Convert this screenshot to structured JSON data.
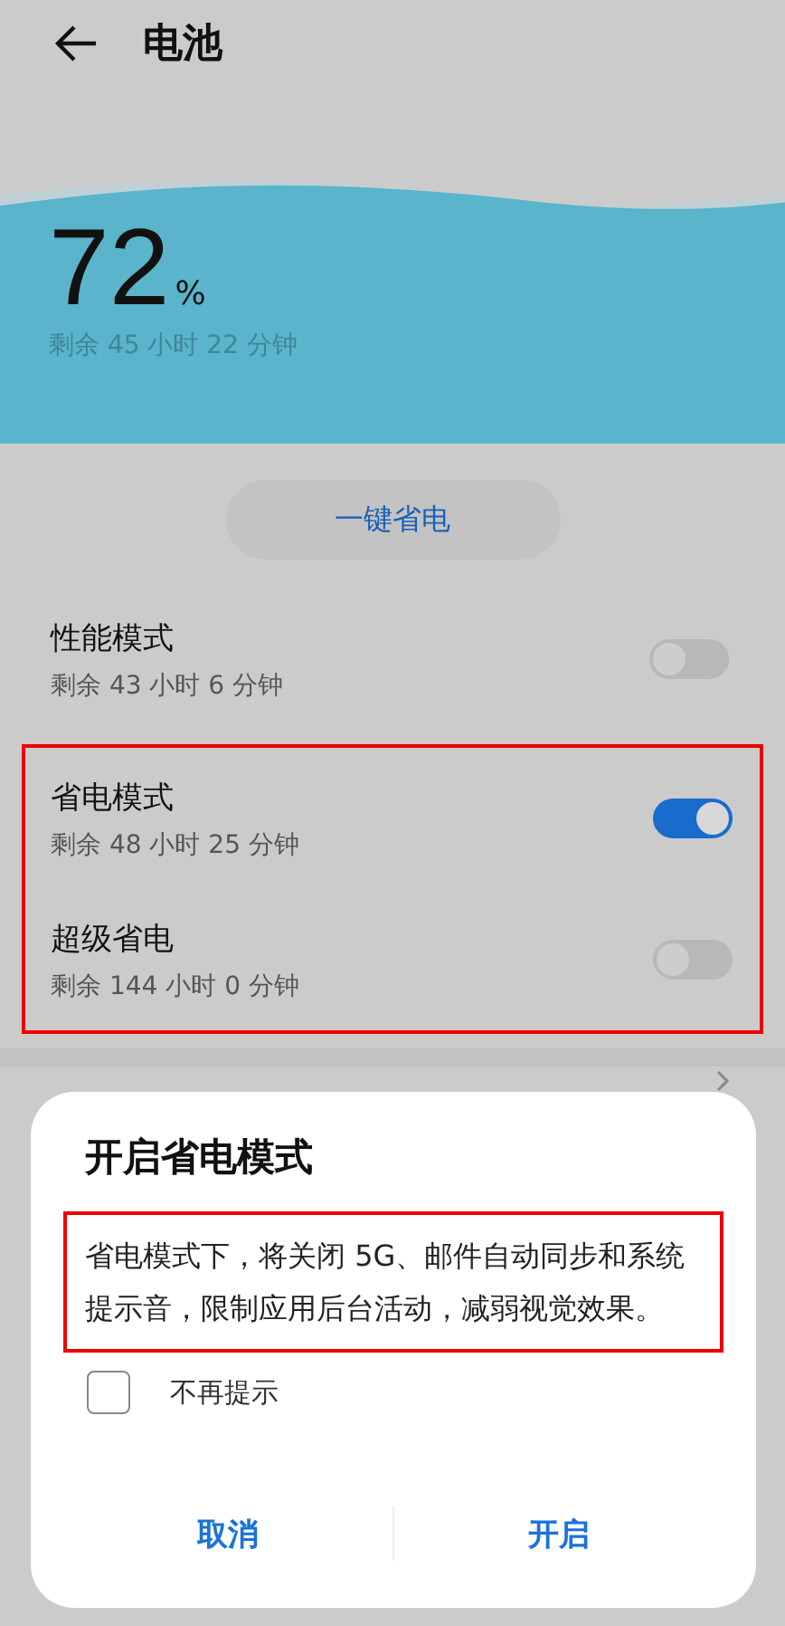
{
  "header": {
    "title": "电池"
  },
  "battery": {
    "percent": "72",
    "unit": "%",
    "remaining": "剩余 45 小时 22 分钟"
  },
  "save_button": "一键省电",
  "modes": [
    {
      "name": "性能模式",
      "remaining": "剩余 43 小时 6 分钟",
      "on": false,
      "highlighted": false
    },
    {
      "name": "省电模式",
      "remaining": "剩余 48 小时 25 分钟",
      "on": true,
      "highlighted": true
    },
    {
      "name": "超级省电",
      "remaining": "剩余 144 小时 0 分钟",
      "on": false,
      "highlighted": true
    }
  ],
  "dialog": {
    "title": "开启省电模式",
    "message": "省电模式下，将关闭 5G、邮件自动同步和系统提示音，限制应用后台活动，减弱视觉效果。",
    "message_highlighted": true,
    "checkbox": {
      "label": "不再提示",
      "checked": false
    },
    "buttons": [
      "取消",
      "开启"
    ]
  }
}
